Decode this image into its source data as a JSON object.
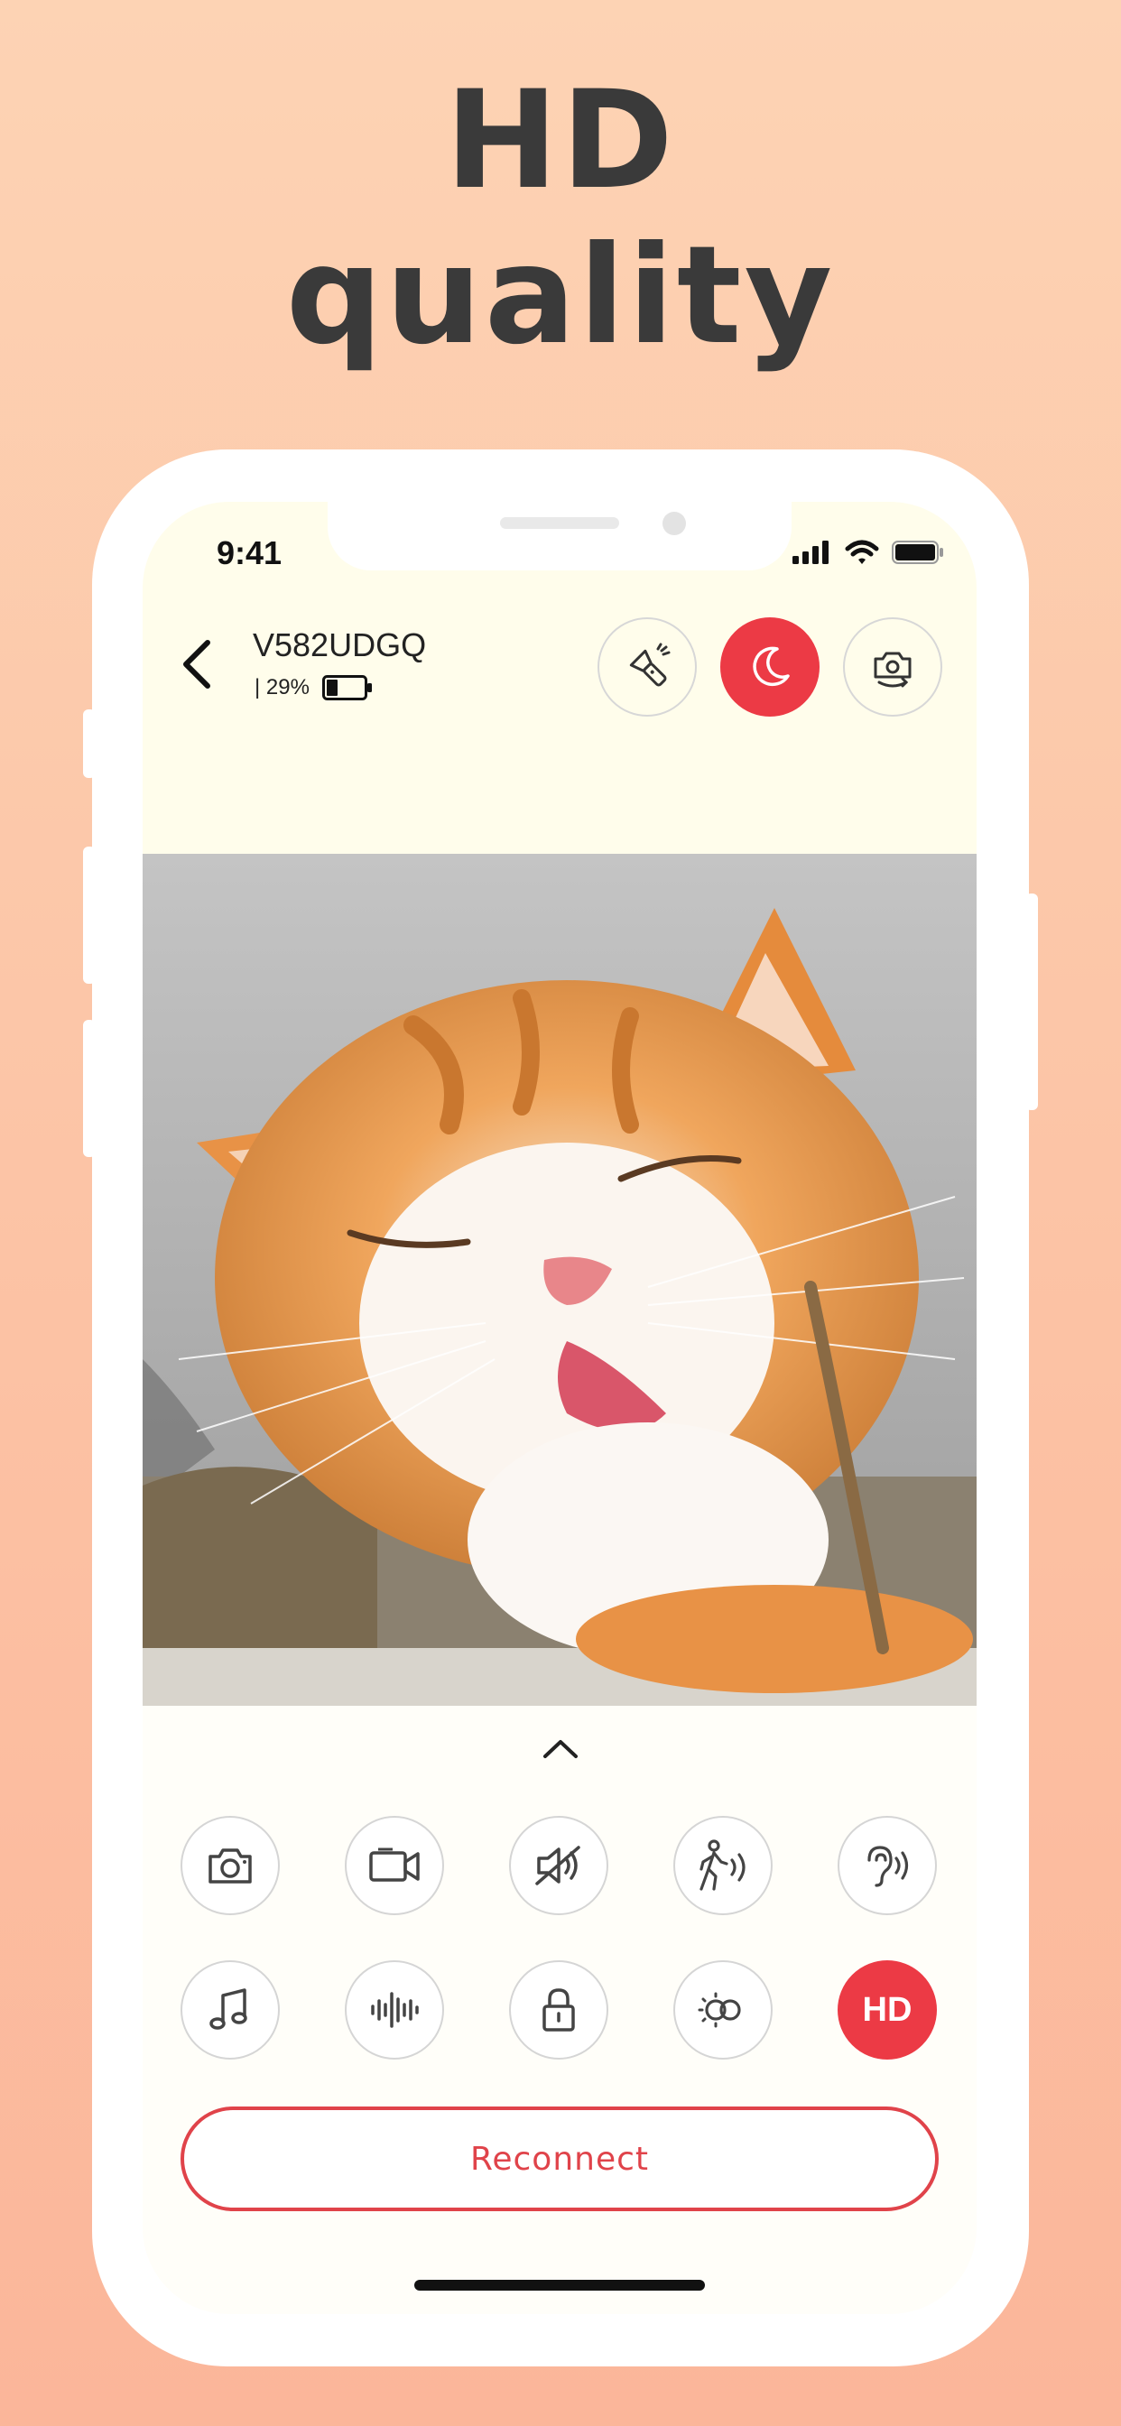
{
  "headline": {
    "line1": "HD",
    "line2": "quality"
  },
  "status_bar": {
    "time": "9:41",
    "icons": [
      "cellular-icon",
      "wifi-icon",
      "battery-icon"
    ]
  },
  "header": {
    "device_name": "V582UDGQ",
    "battery_text": "| 29%",
    "battery_level": 0.29,
    "actions": [
      {
        "name": "flashlight-icon",
        "active": false
      },
      {
        "name": "night-mode-icon",
        "active": true
      },
      {
        "name": "switch-camera-icon",
        "active": false
      }
    ]
  },
  "controls": {
    "row1": [
      "camera-icon",
      "video-record-icon",
      "mute-speaker-icon",
      "motion-detect-icon",
      "listen-icon"
    ],
    "row2": [
      "music-icon",
      "audio-wave-icon",
      "lock-icon",
      "brightness-icon",
      "hd-toggle"
    ],
    "hd_label": "HD"
  },
  "reconnect_label": "Reconnect",
  "colors": {
    "accent": "#ec3a45",
    "top_bg": "#fffdeb",
    "headline": "#3a3a3a"
  }
}
